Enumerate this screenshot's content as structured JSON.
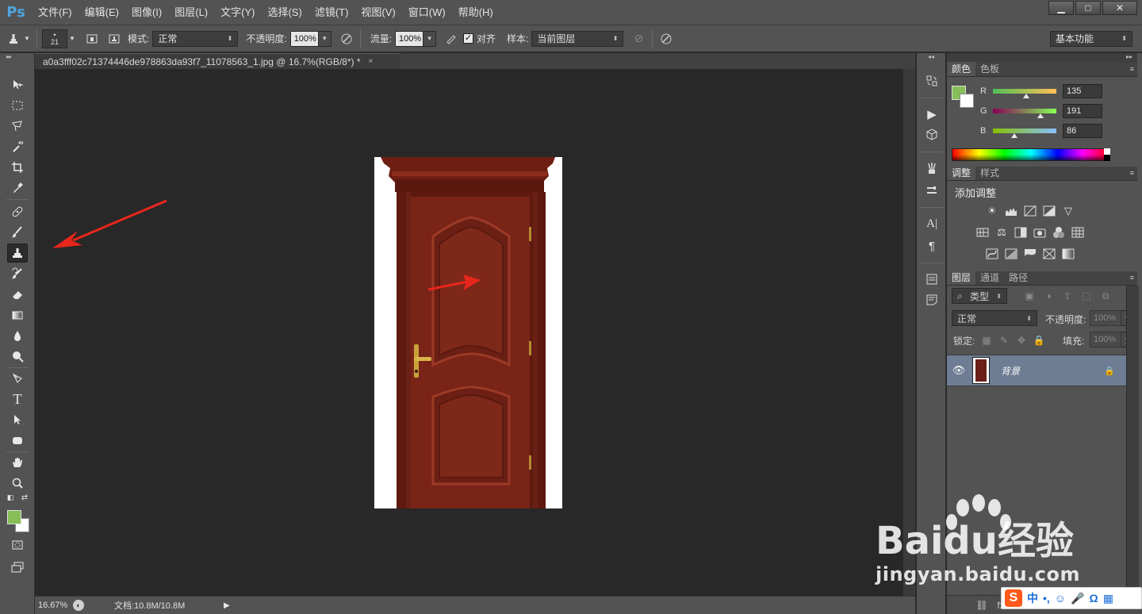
{
  "app": {
    "logo": "Ps"
  },
  "menu": [
    "文件(F)",
    "编辑(E)",
    "图像(I)",
    "图层(L)",
    "文字(Y)",
    "选择(S)",
    "滤镜(T)",
    "视图(V)",
    "窗口(W)",
    "帮助(H)"
  ],
  "window_controls": {
    "minimize": "▁",
    "maximize": "□",
    "close": "✕"
  },
  "options": {
    "brush_size": "21",
    "mode_label": "模式:",
    "mode_value": "正常",
    "opacity_label": "不透明度:",
    "opacity_value": "100%",
    "flow_label": "流量:",
    "flow_value": "100%",
    "align_label": "对齐",
    "sample_label": "样本:",
    "sample_value": "当前图层",
    "workspace": "基本功能"
  },
  "document": {
    "tab_title": "a0a3fff02c71374446de978863da93f7_11078563_1.jpg @ 16.7%(RGB/8*) *",
    "tab_close": "×"
  },
  "status": {
    "zoom": "16.67%",
    "doc_info": "文档:10.8M/10.8M"
  },
  "color_panel": {
    "tabs": [
      "颜色",
      "色板"
    ],
    "r_label": "R",
    "r_value": "135",
    "r_level": 0.53,
    "g_label": "G",
    "g_value": "191",
    "g_level": 0.75,
    "b_label": "B",
    "b_value": "86",
    "b_level": 0.34,
    "foreground": "#87bf56",
    "background": "#ffffff"
  },
  "adjustments_panel": {
    "tabs": [
      "调整",
      "样式"
    ],
    "title": "添加调整"
  },
  "layers_panel": {
    "tabs": [
      "图层",
      "通道",
      "路径"
    ],
    "filter_label": "类型",
    "blend_mode": "正常",
    "opacity_label": "不透明度:",
    "opacity_value": "100%",
    "lock_label": "锁定:",
    "fill_label": "填充:",
    "fill_value": "100%",
    "layer_name": "背景"
  },
  "watermark": {
    "brand": "Baidu经验",
    "url": "jingyan.baidu.com"
  },
  "ime": {
    "logo": "S",
    "mode": "中"
  },
  "colors": {
    "accent_arrow": "#e8261c",
    "door": "#7a2418",
    "layer_selected": "#6e7d94"
  }
}
